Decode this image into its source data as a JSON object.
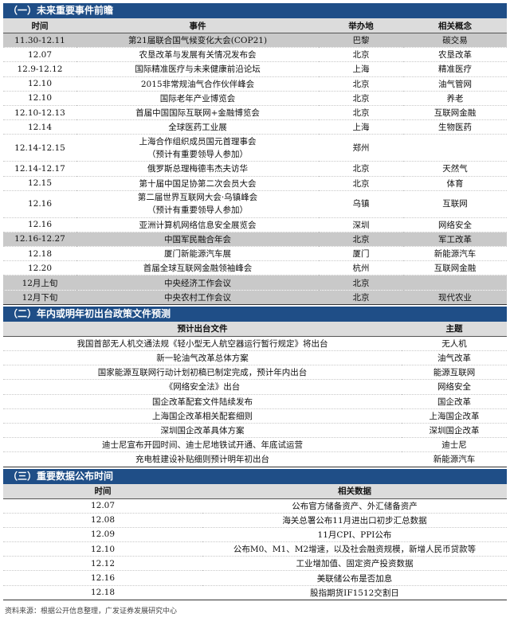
{
  "section1": {
    "title": "（一）未来重要事件前瞻",
    "headers": [
      "时间",
      "事件",
      "举办地",
      "相关概念"
    ],
    "rows": [
      {
        "time": "11.30-12.11",
        "event": "第21届联合国气候变化大会(COP21)",
        "place": "巴黎",
        "concept": "碳交易",
        "grey": true
      },
      {
        "time": "12.07",
        "event": "农垦改革与发展有关情况发布会",
        "place": "北京",
        "concept": "农垦改革"
      },
      {
        "time": "12.9-12.12",
        "event": "国际精准医疗与未来健康前沿论坛",
        "place": "上海",
        "concept": "精准医疗"
      },
      {
        "time": "12.10",
        "event": "2015非常规油气合作伙伴峰会",
        "place": "北京",
        "concept": "油气管网"
      },
      {
        "time": "12.10",
        "event": "国际老年产业博览会",
        "place": "北京",
        "concept": "养老"
      },
      {
        "time": "12.10-12.13",
        "event": "首届中国国际互联网+金融博览会",
        "place": "北京",
        "concept": "互联网金融"
      },
      {
        "time": "12.14",
        "event": "全球医药工业展",
        "place": "上海",
        "concept": "生物医药"
      },
      {
        "time": "12.14-12.15",
        "event": "上海合作组织成员国元首理事会",
        "event2": "（预计有重要领导人参加）",
        "place": "郑州",
        "concept": ""
      },
      {
        "time": "12.14-12.17",
        "event": "俄罗斯总理梅德韦杰夫访华",
        "place": "北京",
        "concept": "天然气"
      },
      {
        "time": "12.15",
        "event": "第十届中国足协第二次会员大会",
        "place": "北京",
        "concept": "体育"
      },
      {
        "time": "12.16",
        "event": "第二届世界互联网大会·乌镇峰会",
        "event2": "（预计有重要领导人参加）",
        "place": "乌镇",
        "concept": "互联网"
      },
      {
        "time": "12.16",
        "event": "亚洲计算机网络信息安全展览会",
        "place": "深圳",
        "concept": "网络安全"
      },
      {
        "time": "12.16-12.27",
        "event": "中国军民融合年会",
        "place": "北京",
        "concept": "军工改革",
        "grey": true
      },
      {
        "time": "12.18",
        "event": "厦门新能源汽车展",
        "place": "厦门",
        "concept": "新能源汽车"
      },
      {
        "time": "12.20",
        "event": "首届全球互联网金融领袖峰会",
        "place": "杭州",
        "concept": "互联网金融"
      },
      {
        "time": "12月上旬",
        "event": "中央经济工作会议",
        "place": "北京",
        "concept": "",
        "grey": true
      },
      {
        "time": "12月下旬",
        "event": "中央农村工作会议",
        "place": "北京",
        "concept": "现代农业",
        "grey": true
      }
    ]
  },
  "section2": {
    "title": "（二）年内或明年初出台政策文件预测",
    "headers": [
      "预计出台文件",
      "主题"
    ],
    "rows": [
      {
        "doc": "我国首部无人机交通法规《轻小型无人航空器运行暂行规定》将出台",
        "topic": "无人机"
      },
      {
        "doc": "新一轮油气改革总体方案",
        "topic": "油气改革"
      },
      {
        "doc": "国家能源互联网行动计划初稿已制定完成，预计年内出台",
        "topic": "能源互联网"
      },
      {
        "doc": "《网络安全法》出台",
        "topic": "网络安全"
      },
      {
        "doc": "国企改革配套文件陆续发布",
        "topic": "国企改革"
      },
      {
        "doc": "上海国企改革相关配套细则",
        "topic": "上海国企改革"
      },
      {
        "doc": "深圳国企改革具体方案",
        "topic": "深圳国企改革"
      },
      {
        "doc": "迪士尼宣布开园时间、迪士尼地铁试开通、年底试运营",
        "topic": "迪士尼"
      },
      {
        "doc": "充电桩建设补贴细则预计明年初出台",
        "topic": "新能源汽车"
      }
    ]
  },
  "section3": {
    "title": "（三）重要数据公布时间",
    "headers": [
      "时间",
      "相关数据"
    ],
    "rows": [
      {
        "time": "12.07",
        "data": "公布官方储备资产、外汇储备资产"
      },
      {
        "time": "12.08",
        "data": "海关总署公布11月进出口初步汇总数据"
      },
      {
        "time": "12.09",
        "data": "11月CPI、PPI公布"
      },
      {
        "time": "12.10",
        "data": "公布M0、M1、M2增速，以及社会融资规模，新增人民币贷款等"
      },
      {
        "time": "12.12",
        "data": "工业增加值、固定资产投资数据"
      },
      {
        "time": "12.16",
        "data": "美联储公布是否加息"
      },
      {
        "time": "12.18",
        "data": "股指期货IF1512交割日"
      }
    ]
  },
  "source": "资料来源：根据公开信息整理，广发证券发展研究中心"
}
